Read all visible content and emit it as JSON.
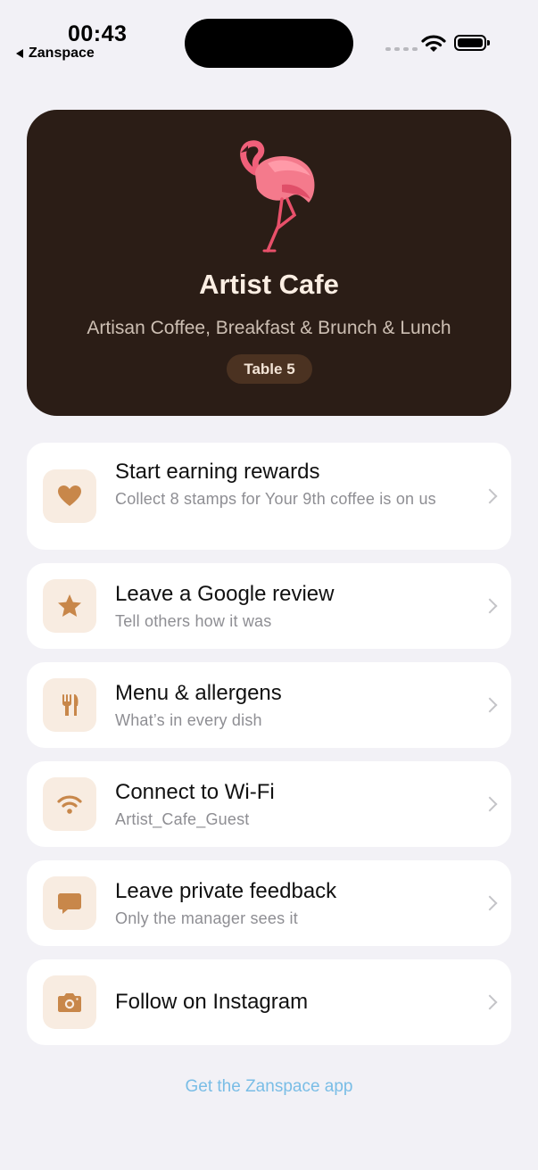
{
  "status_bar": {
    "time": "00:43",
    "back_app": "Zanspace"
  },
  "hero": {
    "name": "Artist Cafe",
    "tagline": "Artisan Coffee, Breakfast & Brunch & Lunch",
    "table": "Table 5",
    "logo_icon": "flamingo-logo"
  },
  "actions": [
    {
      "icon": "heart-icon",
      "title": "Start earning rewards",
      "subtitle": "Collect 8 stamps for Your 9th coffee is on us"
    },
    {
      "icon": "star-icon",
      "title": "Leave a Google review",
      "subtitle": "Tell others how it was"
    },
    {
      "icon": "fork-knife-icon",
      "title": "Menu & allergens",
      "subtitle": "What’s in every dish"
    },
    {
      "icon": "wifi-icon",
      "title": "Connect to Wi-Fi",
      "subtitle": "Artist_Cafe_Guest"
    },
    {
      "icon": "chat-bubble-icon",
      "title": "Leave private feedback",
      "subtitle": "Only the manager sees it"
    },
    {
      "icon": "camera-icon",
      "title": "Follow on Instagram",
      "subtitle": ""
    }
  ],
  "footer": {
    "link": "Get the Zanspace app"
  },
  "colors": {
    "accent": "#c8874a",
    "hero_bg": "#2b1d16",
    "tile_bg": "#f8ece1",
    "link": "#79bde6"
  }
}
